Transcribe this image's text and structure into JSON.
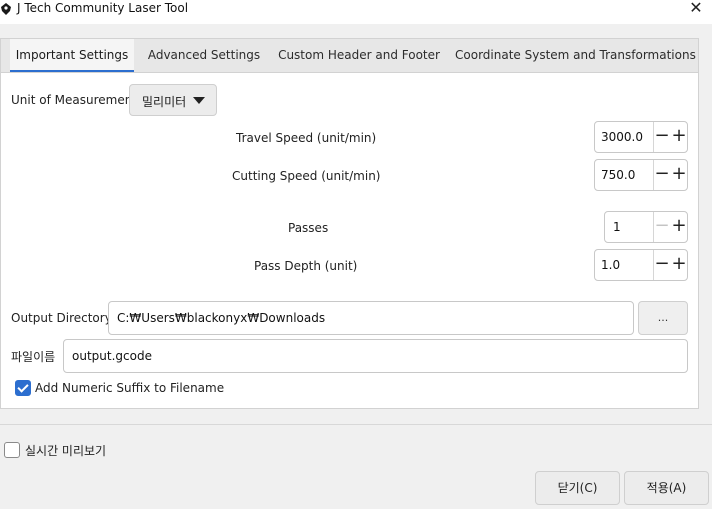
{
  "window": {
    "title": "J Tech Community Laser Tool",
    "close_symbol": "✕"
  },
  "tabs": [
    {
      "label": "Important Settings",
      "active": true
    },
    {
      "label": "Advanced Settings",
      "active": false
    },
    {
      "label": "Custom Header and Footer",
      "active": false
    },
    {
      "label": "Coordinate System and Transformations",
      "active": false
    }
  ],
  "settings": {
    "unit_label": "Unit of Measurement",
    "unit_value": "밀리미터",
    "travel_speed_label": "Travel Speed (unit/min)",
    "travel_speed_value": "3000.0",
    "cutting_speed_label": "Cutting Speed (unit/min)",
    "cutting_speed_value": "750.0",
    "passes_label": "Passes",
    "passes_value": "1",
    "pass_depth_label": "Pass Depth (unit)",
    "pass_depth_value": "1.0",
    "output_dir_label": "Output Directory",
    "output_dir_value": "C:₩Users₩blackonyx₩Downloads",
    "browse_label": "...",
    "filename_label": "파일이름",
    "filename_value": "output.gcode",
    "numeric_suffix_label": "Add Numeric Suffix to Filename",
    "numeric_suffix_checked": true
  },
  "footer": {
    "live_preview_label": "실시간 미리보기",
    "live_preview_checked": false,
    "close_button": "닫기(C)",
    "apply_button": "적용(A)"
  },
  "spin_symbols": {
    "minus": "−",
    "plus": "+"
  },
  "colors": {
    "accent": "#2c6ecf"
  }
}
